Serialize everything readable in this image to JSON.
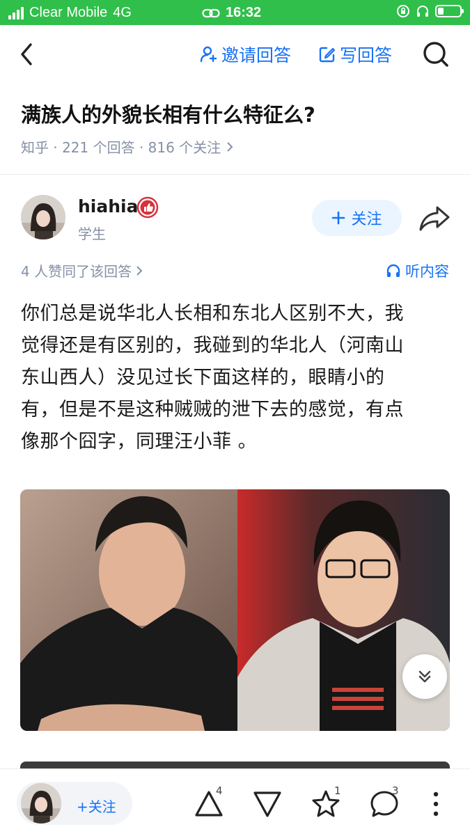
{
  "status_bar": {
    "carrier": "Clear Mobile",
    "network": "4G",
    "time": "16:32",
    "battery_level": 0.25,
    "icons": [
      "signal-icon",
      "link-icon",
      "rotation-lock-icon",
      "headphones-icon",
      "battery-icon"
    ]
  },
  "nav": {
    "invite_label": "邀请回答",
    "write_label": "写回答",
    "icons": [
      "back-icon",
      "invite-icon",
      "edit-icon",
      "search-icon"
    ]
  },
  "question": {
    "title": "满族人的外貌长相有什么特征么?",
    "meta": "知乎 · 221 个回答 · 816 个关注"
  },
  "author": {
    "name": "hiahia",
    "bio": "学生",
    "follow_label": "关注",
    "badge_icon": "thumbs-up-badge-icon",
    "badge_color": "#d6323d"
  },
  "answer": {
    "vote_summary": "4 人赞同了该回答",
    "listen_label": "听内容",
    "lines": [
      "你们总是说华北人长相和东北人区别不大，我",
      "觉得还是有区别的，我碰到的华北人（河南山",
      "东山西人）没见过长下面这样的，眼睛小的",
      "有，但是不是这种贼贼的泄下去的感觉，有点",
      "像那个囧字，同理汪小菲 。"
    ]
  },
  "bottom_bar": {
    "follow_label": "+关注",
    "upvote_count": "4",
    "favorite_count": "1",
    "comment_count": "3",
    "icons": [
      "upvote-icon",
      "downvote-icon",
      "star-icon",
      "comment-icon",
      "more-icon"
    ]
  },
  "colors": {
    "status_bar": "#2fbf4a",
    "accent": "#1772f6",
    "meta_text": "#8590a6",
    "follow_bg": "#ebf5ff"
  }
}
